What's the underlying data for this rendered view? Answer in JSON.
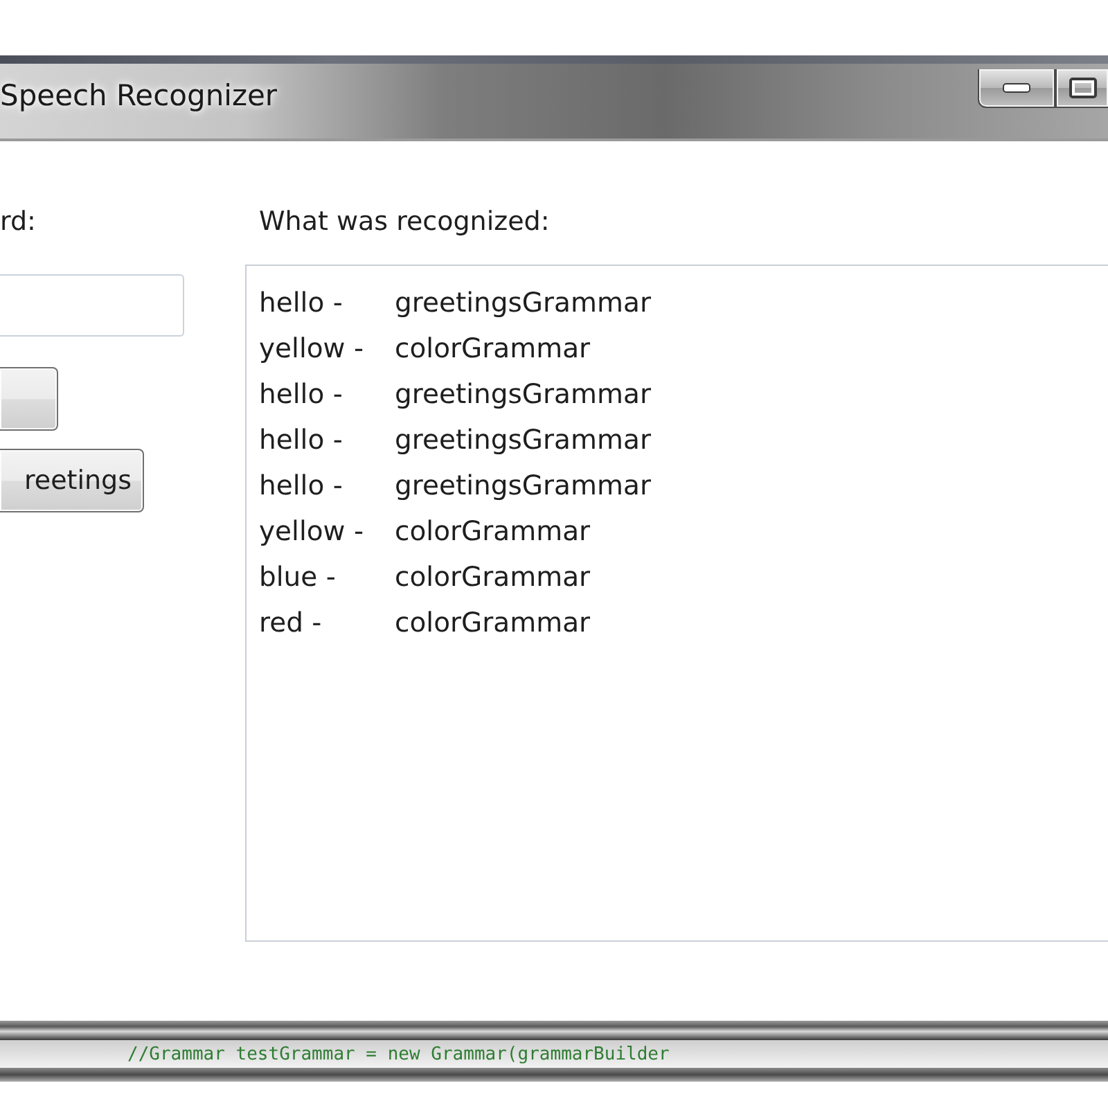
{
  "window": {
    "title": "Speech Recognizer"
  },
  "left_panel": {
    "label": "rd:",
    "greetings_button": {
      "label": "reetings"
    }
  },
  "recognized": {
    "label": "What was recognized:",
    "items": [
      {
        "word": "hello -",
        "grammar": "greetingsGrammar"
      },
      {
        "word": "yellow -",
        "grammar": "colorGrammar"
      },
      {
        "word": "hello -",
        "grammar": "greetingsGrammar"
      },
      {
        "word": "hello -",
        "grammar": "greetingsGrammar"
      },
      {
        "word": "hello -",
        "grammar": "greetingsGrammar"
      },
      {
        "word": "yellow -",
        "grammar": "colorGrammar"
      },
      {
        "word": "blue -",
        "grammar": "colorGrammar"
      },
      {
        "word": "red -",
        "grammar": "colorGrammar"
      }
    ]
  },
  "background_editor": {
    "code_line": "//Grammar testGrammar = new Grammar(grammarBuilder"
  }
}
